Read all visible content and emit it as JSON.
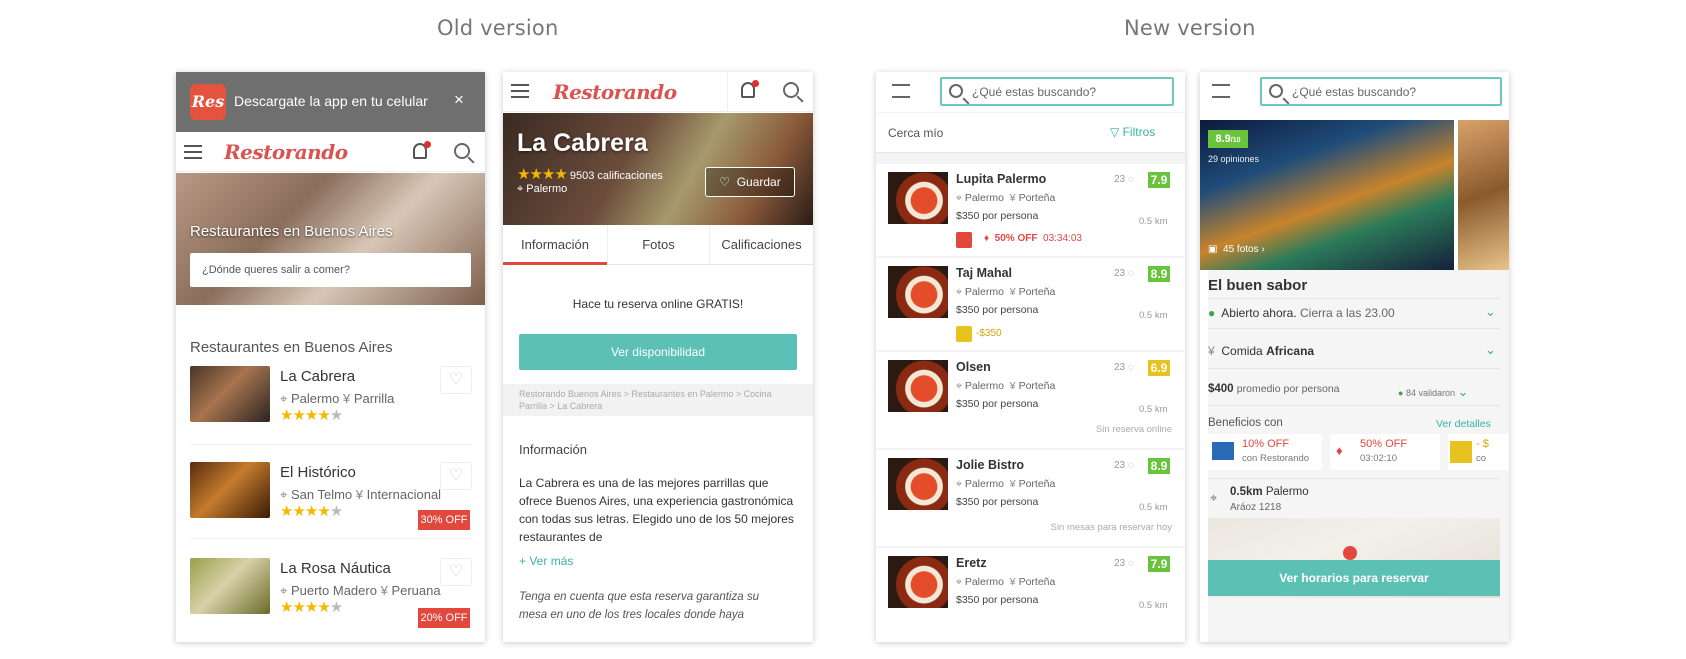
{
  "headings": {
    "old": "Old version",
    "new": "New version"
  },
  "p1": {
    "banner_text": "Descargate la app en tu celular",
    "banner_logo": "Res",
    "close": "×",
    "logo": "Restorando",
    "hero_title": "Restaurantes en Buenos Aires",
    "hero_placeholder": "¿Dónde queres salir a comer?",
    "list_title": "Restaurantes en Buenos Aires",
    "items": [
      {
        "name": "La Cabrera",
        "zone": "Palermo",
        "cuisine": "Parrilla",
        "badge": ""
      },
      {
        "name": "El Histórico",
        "zone": "San Telmo",
        "cuisine": "Internacional",
        "badge": "30% OFF"
      },
      {
        "name": "La Rosa Náutica",
        "zone": "Puerto Madero",
        "cuisine": "Peruana",
        "badge": "20% OFF"
      }
    ]
  },
  "p2": {
    "logo": "Restorando",
    "title": "La Cabrera",
    "ratings": "9503 calificaciones",
    "zone": "Palermo",
    "save": "Guardar",
    "tabs": [
      "Información",
      "Fotos",
      "Calificaciones"
    ],
    "promo": "Hace tu reserva online GRATIS!",
    "cta": "Ver disponibilidad",
    "breadcrumb": "Restorando Buenos Aires > Restaurantes en Palermo > Cocina Parrilla > La Cabrera",
    "info_title": "Información",
    "info_body": "La Cabrera es una de las mejores parrillas que ofrece Buenos Aires, una experiencia gastronómica con todas sus letras. Elegido uno de los 50 mejores restaurantes de",
    "more": "+ Ver más",
    "note": "Tenga en cuenta que esta reserva garantiza su mesa en uno de los tres locales donde haya"
  },
  "p3": {
    "search_placeholder": "¿Qué estas buscando?",
    "near": "Cerca mío",
    "filters": "Filtros",
    "items": [
      {
        "name": "Lupita Palermo",
        "count": "23",
        "score": "7.9",
        "zone": "Palermo",
        "cuisine": "Porteña",
        "price": "$350 por persona",
        "dist": "0.5 km",
        "promo": "50% OFF",
        "timer": "03:34:03",
        "note": ""
      },
      {
        "name": "Taj Mahal",
        "count": "23",
        "score": "8.9",
        "zone": "Palermo",
        "cuisine": "Porteña",
        "price": "$350 por persona",
        "dist": "0.5 km",
        "promo": "-$350",
        "timer": "",
        "note": ""
      },
      {
        "name": "Olsen",
        "count": "23",
        "score": "6.9",
        "zone": "Palermo",
        "cuisine": "Porteña",
        "price": "$350 por persona",
        "dist": "0.5 km",
        "promo": "",
        "timer": "",
        "note": "Sin reserva online"
      },
      {
        "name": "Jolie Bistro",
        "count": "23",
        "score": "8.9",
        "zone": "Palermo",
        "cuisine": "Porteña",
        "price": "$350 por persona",
        "dist": "0.5 km",
        "promo": "",
        "timer": "",
        "note": "Sin mesas para reservar hoy"
      },
      {
        "name": "Eretz",
        "count": "23",
        "score": "7.9",
        "zone": "Palermo",
        "cuisine": "Porteña",
        "price": "$350 por persona",
        "dist": "0.5 km",
        "promo": "",
        "timer": "",
        "note": ""
      }
    ]
  },
  "p4": {
    "search_placeholder": "¿Qué estas buscando?",
    "score": "8.9",
    "score_max": "/10",
    "opinions": "29 opiniones",
    "photos": "45 fotos",
    "name": "El buen sabor",
    "open": "Abierto ahora.",
    "closes": "Cierra a las 23.00",
    "food_prefix": "Comida",
    "food": "Africana",
    "avg": "$400",
    "avg_label": "promedio por persona",
    "validated": "84 validaron",
    "benefits": "Beneficios con",
    "details": "Ver detalles",
    "b1_title": "10% OFF",
    "b1_sub": "con Restorando",
    "b2_title": "50% OFF",
    "b2_sub": "03:02:10",
    "b3_title": "- $",
    "b3_sub": "co",
    "dist": "0.5km",
    "zone": "Palermo",
    "address": "Aráoz 1218",
    "cta": "Ver horarios para reservar"
  }
}
